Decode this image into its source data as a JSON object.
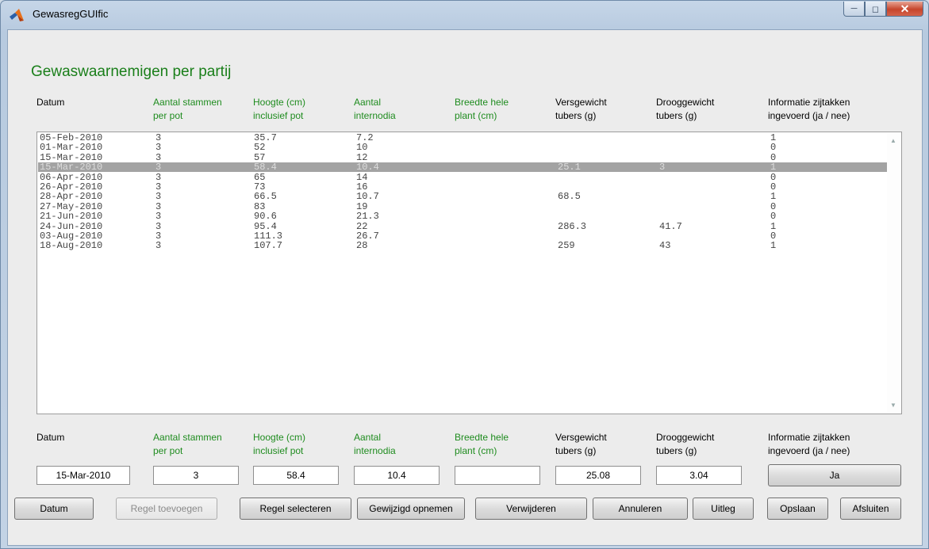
{
  "window": {
    "title": "GewasregGUIfic"
  },
  "heading": "Gewaswaarnemigen per partij",
  "columns": [
    {
      "l1": "",
      "l2": "Datum"
    },
    {
      "l1": "Aantal stammen",
      "l2": "per pot"
    },
    {
      "l1": "Hoogte (cm)",
      "l2": "inclusief pot"
    },
    {
      "l1": "Aantal",
      "l2": "internodia"
    },
    {
      "l1": "Breedte hele",
      "l2": "plant (cm)"
    },
    {
      "l1": "Versgewicht",
      "l2": "tubers (g)"
    },
    {
      "l1": "Drooggewicht",
      "l2": "tubers (g)"
    },
    {
      "l1": "Informatie zijtakken",
      "l2": "ingevoerd (ja / nee)"
    }
  ],
  "rows": [
    [
      "05-Feb-2010",
      "3",
      "35.7",
      "7.2",
      "",
      "",
      "",
      "1"
    ],
    [
      "01-Mar-2010",
      "3",
      "52",
      "10",
      "",
      "",
      "",
      "0"
    ],
    [
      "15-Mar-2010",
      "3",
      "57",
      "12",
      "",
      "",
      "",
      "0"
    ],
    [
      "15-Mar-2010",
      "3",
      "58.4",
      "10.4",
      "",
      "25.1",
      "3",
      "1"
    ],
    [
      "06-Apr-2010",
      "3",
      "65",
      "14",
      "",
      "",
      "",
      "0"
    ],
    [
      "26-Apr-2010",
      "3",
      "73",
      "16",
      "",
      "",
      "",
      "0"
    ],
    [
      "28-Apr-2010",
      "3",
      "66.5",
      "10.7",
      "",
      "68.5",
      "",
      "1"
    ],
    [
      "27-May-2010",
      "3",
      "83",
      "19",
      "",
      "",
      "",
      "0"
    ],
    [
      "21-Jun-2010",
      "3",
      "90.6",
      "21.3",
      "",
      "",
      "",
      "0"
    ],
    [
      "24-Jun-2010",
      "3",
      "95.4",
      "22",
      "",
      "286.3",
      "41.7",
      "1"
    ],
    [
      "03-Aug-2010",
      "3",
      "111.3",
      "26.7",
      "",
      "",
      "",
      "0"
    ],
    [
      "18-Aug-2010",
      "3",
      "107.7",
      "28",
      "",
      "259",
      "43",
      "1"
    ]
  ],
  "selected_row_index": 3,
  "edit": {
    "datum": "15-Mar-2010",
    "stammen": "3",
    "hoogte": "58.4",
    "internodia": "10.4",
    "breedte": "",
    "versgewicht": "25.08",
    "drooggewicht": "3.04",
    "zijtakken": "Ja"
  },
  "buttons": {
    "datum": "Datum",
    "regel_toevoegen": "Regel toevoegen",
    "regel_selecteren": "Regel selecteren",
    "gewijzigd_opnemen": "Gewijzigd opnemen",
    "verwijderen": "Verwijderen",
    "annuleren": "Annuleren",
    "uitleg": "Uitleg",
    "opslaan": "Opslaan",
    "afsluiten": "Afsluiten"
  },
  "colors": {
    "heading": "#1a7f1a",
    "label_green": "#1f8c1f",
    "selected_row": "#a3a3a3"
  },
  "icons": [
    "matlab-logo-icon",
    "minimize-icon",
    "maximize-icon",
    "close-icon",
    "scroll-up-icon",
    "scroll-down-icon"
  ]
}
